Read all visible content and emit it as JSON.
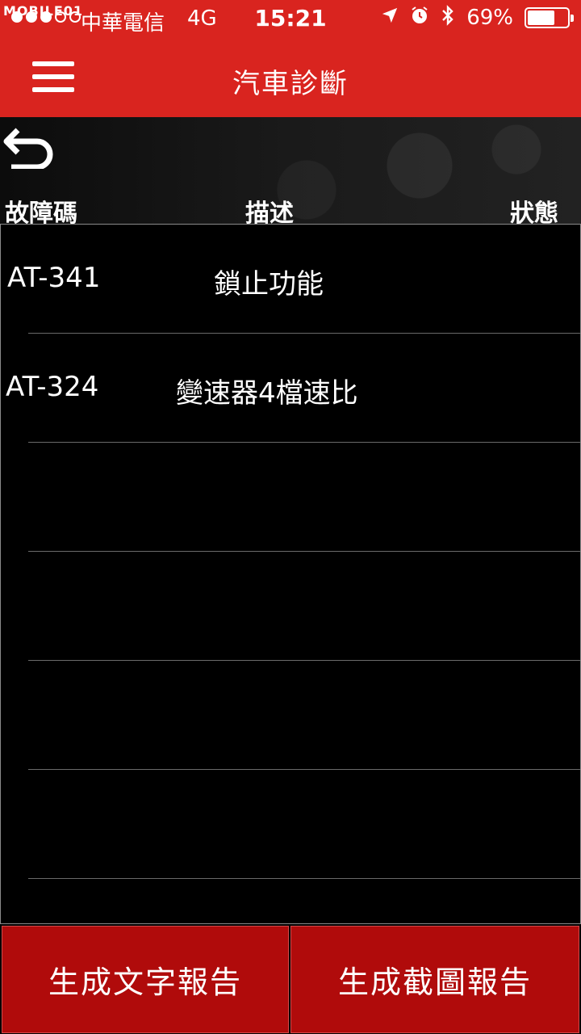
{
  "status_bar": {
    "watermark": "MOBILE01",
    "carrier": "中華電信",
    "network": "4G",
    "time": "15:21",
    "battery_percent_text": "69%",
    "battery_level": 0.69,
    "signal_bars_filled": 3,
    "signal_bars_total": 5,
    "icons": [
      "location-arrow-icon",
      "alarm-clock-icon",
      "bluetooth-icon"
    ]
  },
  "navbar": {
    "title": "汽車診斷",
    "menu_icon": "hamburger-menu-icon"
  },
  "subheader": {
    "back_icon": "back-arrow-icon",
    "columns": {
      "code": "故障碼",
      "description": "描述",
      "status": "狀態"
    }
  },
  "faults": [
    {
      "code": "AT-341",
      "description": "鎖止功能",
      "status": ""
    },
    {
      "code": "AT-324",
      "description": "變速器4檔速比",
      "status": ""
    }
  ],
  "buttons": {
    "text_report": "生成文字報告",
    "screenshot_report": "生成截圖報告"
  },
  "colors": {
    "header_red": "#d9241f",
    "button_red": "#b00b0b",
    "background": "#000000"
  }
}
